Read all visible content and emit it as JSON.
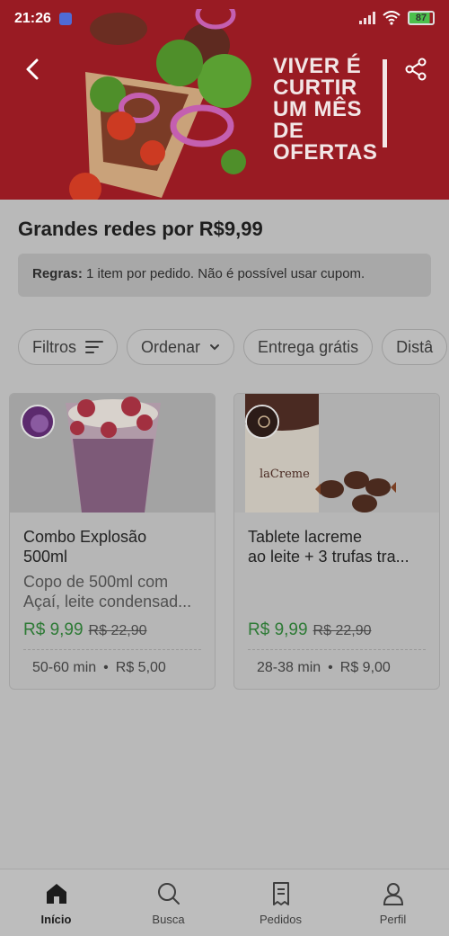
{
  "status_bar": {
    "time": "21:26",
    "battery": "87"
  },
  "hero": {
    "headline_lines": [
      "VIVER É",
      "CURTIR",
      "UM MÊS DE",
      "OFERTAS"
    ],
    "back_icon": "chevron-left-icon",
    "share_icon": "share-icon"
  },
  "page": {
    "title": "Grandes redes por R$9,99",
    "rules_label": "Regras:",
    "rules_text": " 1 item por pedido. Não é possível usar cupom."
  },
  "filters": [
    {
      "label": "Filtros",
      "icon": "filter-lines-icon"
    },
    {
      "label": "Ordenar",
      "icon": "chevron-down-icon"
    },
    {
      "label": "Entrega grátis"
    },
    {
      "label": "Distâ"
    }
  ],
  "products": [
    {
      "title_lines": [
        "Combo Explosão",
        "500ml"
      ],
      "desc_lines": [
        "Copo de 500ml com",
        "Açaí, leite condensad..."
      ],
      "price": "R$ 9,99",
      "old_price": "R$ 22,90",
      "time": "50-60 min",
      "separator": "•",
      "fee": "R$ 5,00"
    },
    {
      "title_lines": [
        "Tablete lacreme",
        "ao leite + 3 trufas tra..."
      ],
      "desc_lines": [],
      "price": "R$ 9,99",
      "old_price": "R$ 22,90",
      "time": "28-38 min",
      "separator": "•",
      "fee": "R$ 9,00",
      "image_text": "laCreme"
    }
  ],
  "bottom_nav": [
    {
      "label": "Início",
      "icon": "home-icon",
      "active": true
    },
    {
      "label": "Busca",
      "icon": "search-icon",
      "active": false
    },
    {
      "label": "Pedidos",
      "icon": "receipt-icon",
      "active": false
    },
    {
      "label": "Perfil",
      "icon": "person-icon",
      "active": false
    }
  ],
  "colors": {
    "hero_red": "#991b23",
    "price_green": "#2d7a35",
    "overlay_background": "#b9b9b9"
  }
}
